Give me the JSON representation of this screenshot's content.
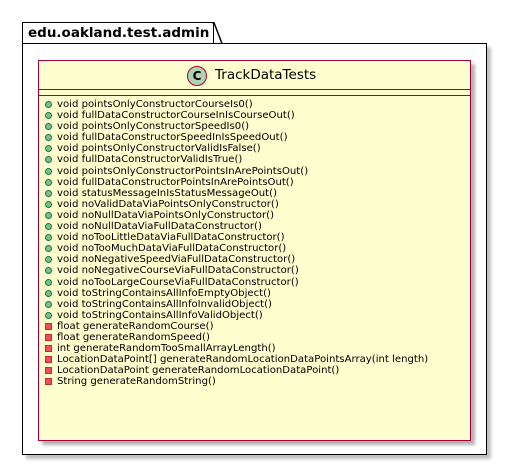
{
  "package": {
    "name": "edu.oakland.test.admin"
  },
  "class": {
    "stereotype_letter": "C",
    "name": "TrackDataTests",
    "methods": [
      {
        "visibility": "public",
        "text": "void pointsOnlyConstructorCourseIs0()"
      },
      {
        "visibility": "public",
        "text": "void fullDataConstructorCourseInIsCourseOut()"
      },
      {
        "visibility": "public",
        "text": "void pointsOnlyConstructorSpeedIs0()"
      },
      {
        "visibility": "public",
        "text": "void fullDataConstructorSpeedInIsSpeedOut()"
      },
      {
        "visibility": "public",
        "text": "void pointsOnlyConstructorValidIsFalse()"
      },
      {
        "visibility": "public",
        "text": "void fullDataConstructorValidIsTrue()"
      },
      {
        "visibility": "public",
        "text": "void pointsOnlyConstructorPointsInArePointsOut()"
      },
      {
        "visibility": "public",
        "text": "void fullDataConstructorPointsInArePointsOut()"
      },
      {
        "visibility": "public",
        "text": "void statusMessageInIsStatusMessageOut()"
      },
      {
        "visibility": "public",
        "text": "void noValidDataViaPointsOnlyConstructor()"
      },
      {
        "visibility": "public",
        "text": "void noNullDataViaPointsOnlyConstructor()"
      },
      {
        "visibility": "public",
        "text": "void noNullDataViaFullDataConstructor()"
      },
      {
        "visibility": "public",
        "text": "void noTooLittleDataViaFullDataConstructor()"
      },
      {
        "visibility": "public",
        "text": "void noTooMuchDataViaFullDataConstructor()"
      },
      {
        "visibility": "public",
        "text": "void noNegativeSpeedViaFullDataConstructor()"
      },
      {
        "visibility": "public",
        "text": "void noNegativeCourseViaFullDataConstructor()"
      },
      {
        "visibility": "public",
        "text": "void noTooLargeCourseViaFullDataConstructor()"
      },
      {
        "visibility": "public",
        "text": "void toStringContainsAllInfoEmptyObject()"
      },
      {
        "visibility": "public",
        "text": "void toStringContainsAllInfoInvalidObject()"
      },
      {
        "visibility": "public",
        "text": "void toStringContainsAllInfoValidObject()"
      },
      {
        "visibility": "private",
        "text": "float generateRandomCourse()"
      },
      {
        "visibility": "private",
        "text": "float generateRandomSpeed()"
      },
      {
        "visibility": "private",
        "text": "int generateRandomTooSmallArrayLength()"
      },
      {
        "visibility": "private",
        "text": "LocationDataPoint[] generateRandomLocationDataPointsArray(int length)"
      },
      {
        "visibility": "private",
        "text": "LocationDataPoint generateRandomLocationDataPoint()"
      },
      {
        "visibility": "private",
        "text": "String generateRandomString()"
      }
    ]
  },
  "colors": {
    "class_fill": "#fefece",
    "class_border": "#a80036",
    "stereotype_fill": "#add1b2",
    "public_marker": "#84be84",
    "private_marker": "#f24d5c"
  }
}
